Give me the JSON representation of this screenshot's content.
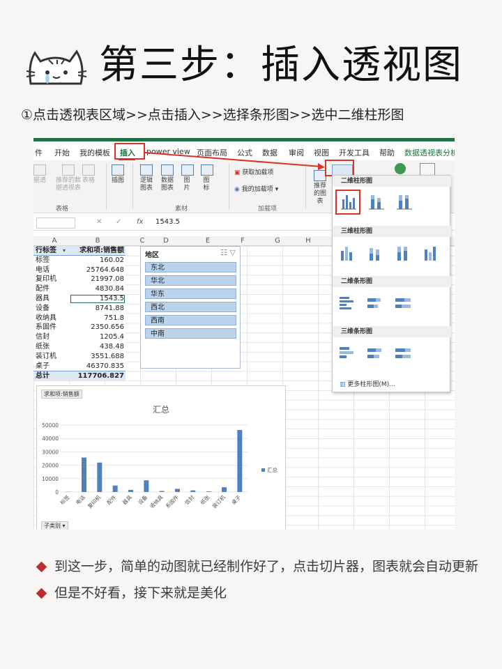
{
  "title": "第三步：插入透视图",
  "subtitle": "①点击透视表区域>>点击插入>>选择条形图>>选中二维柱形图",
  "ribbon_tabs": [
    "件",
    "开始",
    "我的模板",
    "插入",
    "power view",
    "页面布局",
    "公式",
    "数据",
    "审阅",
    "视图",
    "开发工具",
    "帮助",
    "数据透视表分析"
  ],
  "ribbon_buttons": {
    "recommended_pivot": "推荐的数据透视表",
    "pivot_short": "据透",
    "table": "表格",
    "illustration": "插图",
    "logic_chart": "逻辑图表",
    "data_chart": "数据图表",
    "picture": "图片",
    "icon": "图标",
    "get_addins": "获取加载项",
    "my_addins": "我的加载项",
    "recommended_chart": "推荐的图表"
  },
  "ribbon_groups": {
    "tables": "表格",
    "material": "素材",
    "addins": "加载项"
  },
  "formula_bar": {
    "fx": "fx",
    "value": "1543.5"
  },
  "columns": [
    "A",
    "B",
    "C",
    "D",
    "E",
    "F",
    "G",
    "H"
  ],
  "pivot": {
    "header_label": "行标签",
    "header_value": "求和项:销售额",
    "rows": [
      {
        "label": "标签",
        "value": "160.02"
      },
      {
        "label": "电话",
        "value": "25764.648"
      },
      {
        "label": "复印机",
        "value": "21997.08"
      },
      {
        "label": "配件",
        "value": "4830.84"
      },
      {
        "label": "器具",
        "value": "1543.5"
      },
      {
        "label": "设备",
        "value": "8741.88"
      },
      {
        "label": "收纳具",
        "value": "751.8"
      },
      {
        "label": "系固件",
        "value": "2350.656"
      },
      {
        "label": "信封",
        "value": "1205.4"
      },
      {
        "label": "纸张",
        "value": "438.48"
      },
      {
        "label": "装订机",
        "value": "3551.688"
      },
      {
        "label": "桌子",
        "value": "46370.835"
      }
    ],
    "total_label": "总计",
    "total_value": "117706.827"
  },
  "slicer": {
    "title": "地区",
    "items": [
      "东北",
      "华北",
      "华东",
      "西北",
      "西南",
      "中南"
    ]
  },
  "chart_tag": "求和项:销售额",
  "chart_foot": "子类别",
  "chart_data": {
    "type": "bar",
    "title": "汇总",
    "categories": [
      "标签",
      "电话",
      "复印机",
      "配件",
      "器具",
      "设备",
      "收纳具",
      "系固件",
      "信封",
      "纸张",
      "装订机",
      "桌子"
    ],
    "series": [
      {
        "name": "汇总",
        "values": [
          160.02,
          25764.648,
          21997.08,
          4830.84,
          1543.5,
          8741.88,
          751.8,
          2350.656,
          1205.4,
          438.48,
          3551.688,
          46370.835
        ]
      }
    ],
    "yticks": [
      "0",
      "10000",
      "20000",
      "30000",
      "40000",
      "50000"
    ],
    "ylim": [
      0,
      50000
    ],
    "legend": "right",
    "color": "#4f81bd"
  },
  "dropdown": {
    "sections": [
      "二维柱形图",
      "三维柱形图",
      "二维条形图",
      "三维条形图"
    ],
    "more": "更多柱形图(M)..."
  },
  "bullets": [
    "到这一步，简单的动图就已经制作好了，点击切片器，图表就会自动更新",
    "但是不好看，接下来就是美化"
  ],
  "colors": {
    "accent": "#217346",
    "highlight": "#d9332b",
    "bar": "#4f81bd",
    "bullet": "#c22b2b"
  }
}
